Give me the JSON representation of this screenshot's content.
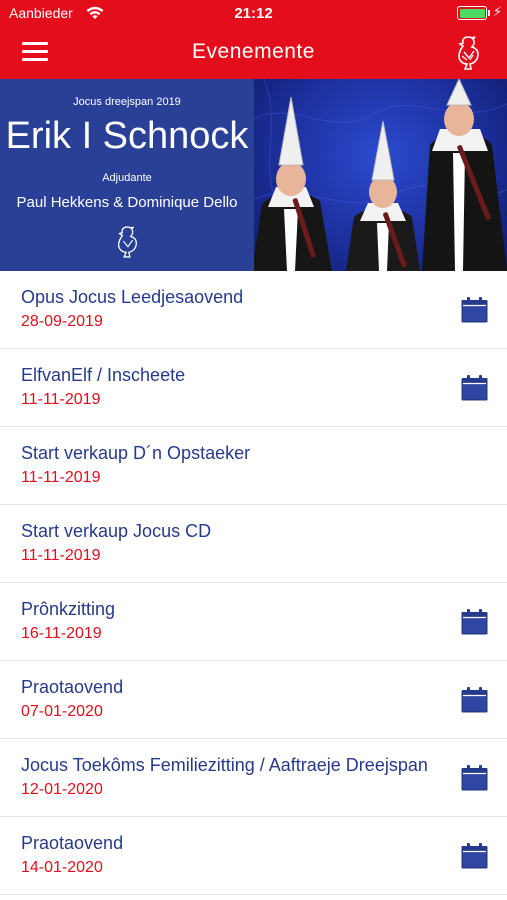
{
  "status_bar": {
    "carrier": "Aanbieder",
    "time": "21:12",
    "battery_level": 1.0
  },
  "nav": {
    "title": "Evenemente",
    "menu_icon": "hamburger-menu-icon",
    "logo_icon": "rooster-logo-icon"
  },
  "banner": {
    "subtitle": "Jocus dreejspan 2019",
    "name": "Erik I Schnock",
    "role": "Adjudante",
    "adjudants": "Paul Hekkens & Dominique Dello",
    "logo_icon": "rooster-logo-icon",
    "photo_description_icon": "group-photo"
  },
  "events": [
    {
      "title": "Opus Jocus Leedjesaovend",
      "date": "28-09-2019",
      "has_calendar": true
    },
    {
      "title": "ElfvanElf / Inscheete",
      "date": "11-11-2019",
      "has_calendar": true
    },
    {
      "title": "Start verkaup D´n Opstaeker",
      "date": "11-11-2019",
      "has_calendar": false
    },
    {
      "title": "Start verkaup Jocus CD",
      "date": "11-11-2019",
      "has_calendar": false
    },
    {
      "title": "Prônkzitting",
      "date": "16-11-2019",
      "has_calendar": true
    },
    {
      "title": "Praotaovend",
      "date": "07-01-2020",
      "has_calendar": true
    },
    {
      "title": "Jocus Toekôms Femiliezitting / Aaftraeje Dreejspan",
      "date": "12-01-2020",
      "has_calendar": true
    },
    {
      "title": "Praotaovend",
      "date": "14-01-2020",
      "has_calendar": true
    }
  ],
  "colors": {
    "brand_red": "#e30d1b",
    "brand_blue": "#2a4096",
    "title_blue": "#263a8c"
  }
}
